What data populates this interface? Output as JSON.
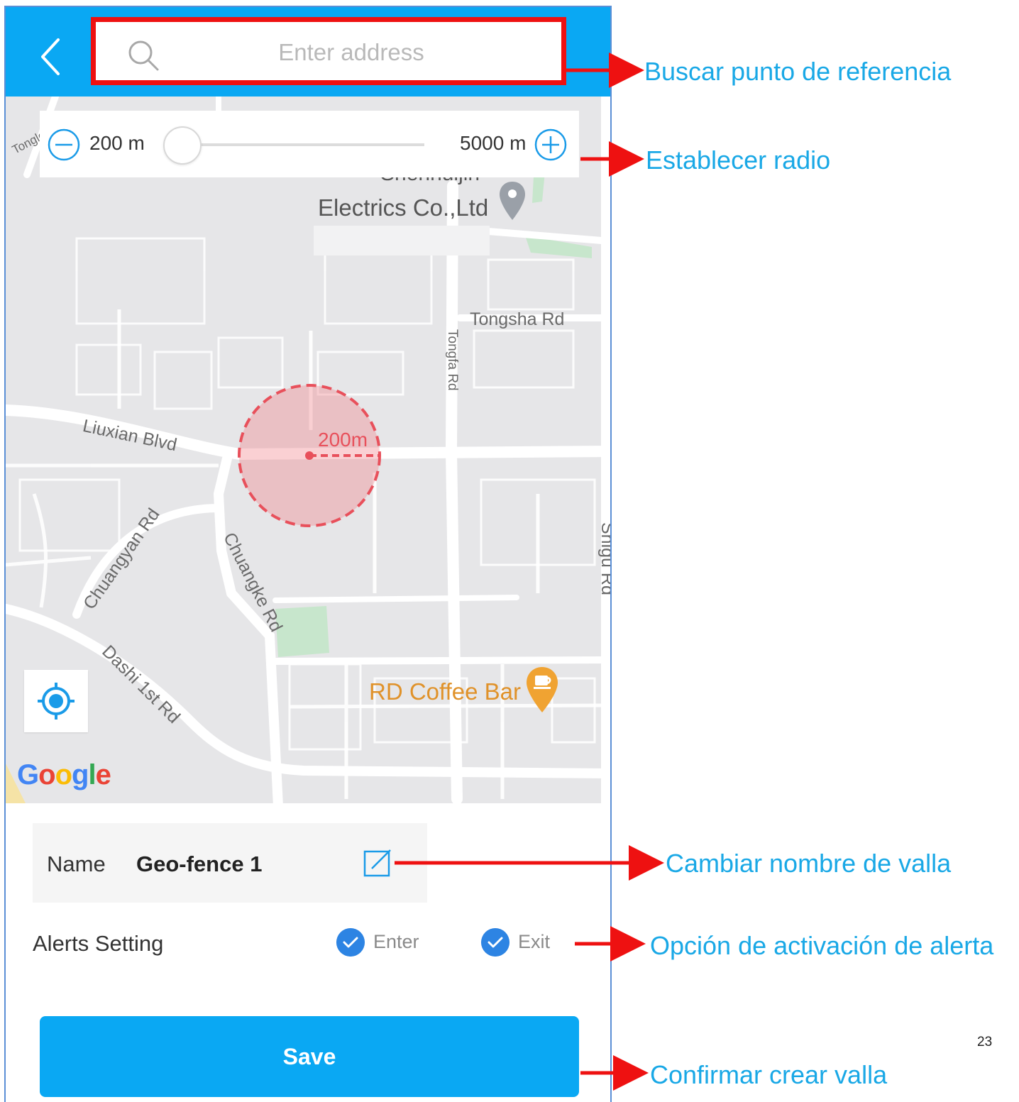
{
  "search": {
    "placeholder": "Enter address"
  },
  "radius": {
    "min_label": "200 m",
    "max_label": "5000 m",
    "value_fraction": 0
  },
  "map": {
    "streets": [
      "Tongle",
      "Tongsha Rd",
      "Tongfa Rd",
      "Liuxian Blvd",
      "Chuangyan Rd",
      "Chuangke Rd",
      "Dashi 1st Rd",
      "Shigu Rd"
    ],
    "poi_electrics_top": "Shenhuijin",
    "poi_electrics": "Electrics Co.,Ltd",
    "poi_coffee": "RD Coffee Bar",
    "fence_radius_label": "200m",
    "attribution": [
      "G",
      "o",
      "o",
      "g",
      "l",
      "e"
    ],
    "attribution_colors": [
      "#4285F4",
      "#EA4335",
      "#FBBC05",
      "#4285F4",
      "#34A853",
      "#EA4335"
    ]
  },
  "name_row": {
    "key": "Name",
    "value": "Geo-fence 1"
  },
  "alerts": {
    "label": "Alerts Setting",
    "enter": "Enter",
    "exit": "Exit",
    "enter_checked": true,
    "exit_checked": true
  },
  "save_label": "Save",
  "annotations": {
    "search": "Buscar punto de referencia",
    "radius": "Establecer radio",
    "rename": "Cambiar nombre de valla",
    "alerts": "Opción de activación de alerta",
    "save": "Confirmar crear valla"
  },
  "page_number": "23",
  "colors": {
    "accent": "#0aa8f3",
    "highlight_box": "#ee1111",
    "annotation_text": "#19a8e6",
    "annotation_arrow": "#ee1111",
    "fence": "#e8505b",
    "checkbox": "#2d84e3",
    "coffee_pin": "#f0a332"
  }
}
